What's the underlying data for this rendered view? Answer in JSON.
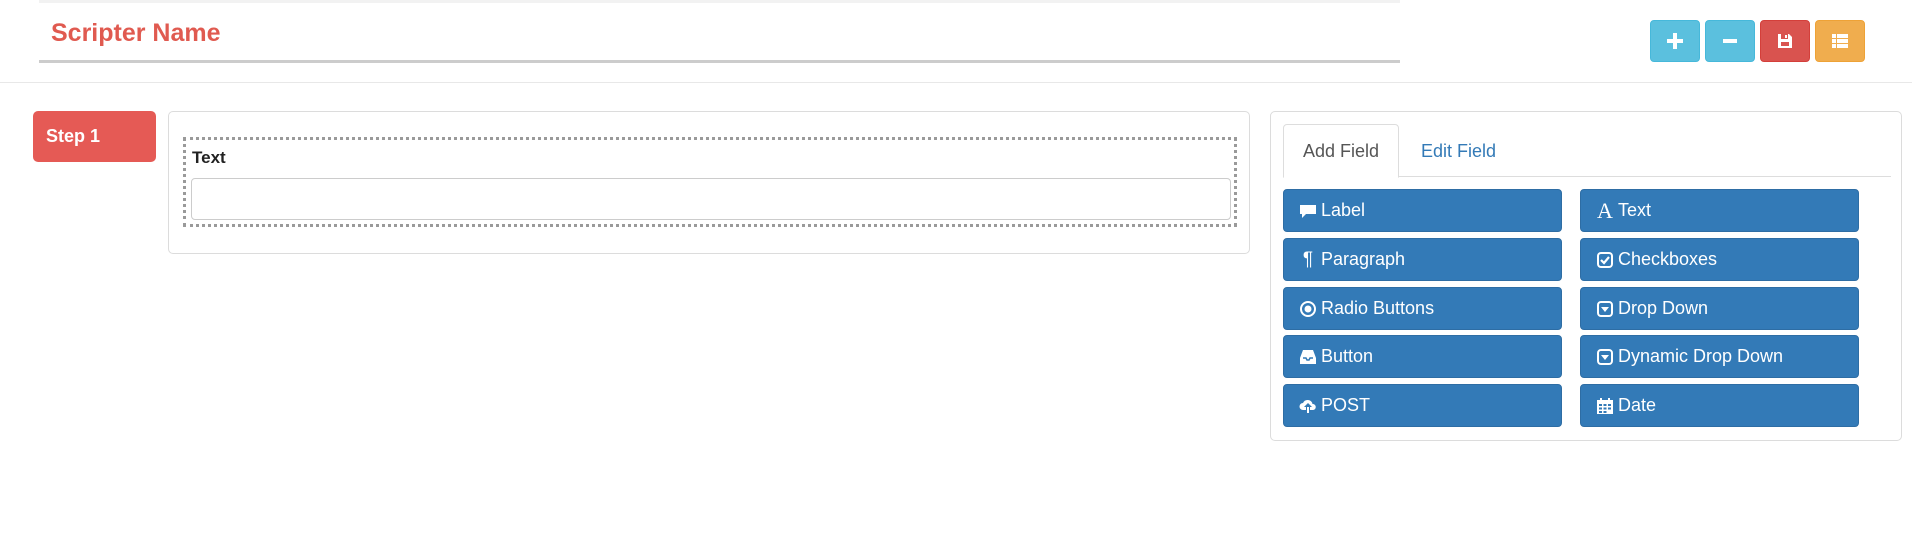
{
  "header": {
    "title": "Scripter Name",
    "toolbar": [
      {
        "icon": "plus-icon",
        "glyph": "+",
        "color": "#5bc0de"
      },
      {
        "icon": "minus-icon",
        "glyph": "−",
        "color": "#5bc0de"
      },
      {
        "icon": "save-icon",
        "glyph": "",
        "color": "#d9534f"
      },
      {
        "icon": "list-icon",
        "glyph": "",
        "color": "#f0ad4e"
      }
    ]
  },
  "steps": {
    "active_label": "Step 1",
    "color": "#e55a55"
  },
  "canvas": {
    "field_label": "Text",
    "field_value": ""
  },
  "palette": {
    "tabs": {
      "add": "Add Field",
      "edit": "Edit Field",
      "active": "Add Field"
    },
    "buttons": {
      "label": "Label",
      "text": "Text",
      "paragraph": "Paragraph",
      "checkboxes": "Checkboxes",
      "radio": "Radio Buttons",
      "dropdown": "Drop Down",
      "button": "Button",
      "dynamic_dropdown": "Dynamic Drop Down",
      "post": "POST",
      "date": "Date"
    },
    "button_color": "#337ab7"
  }
}
